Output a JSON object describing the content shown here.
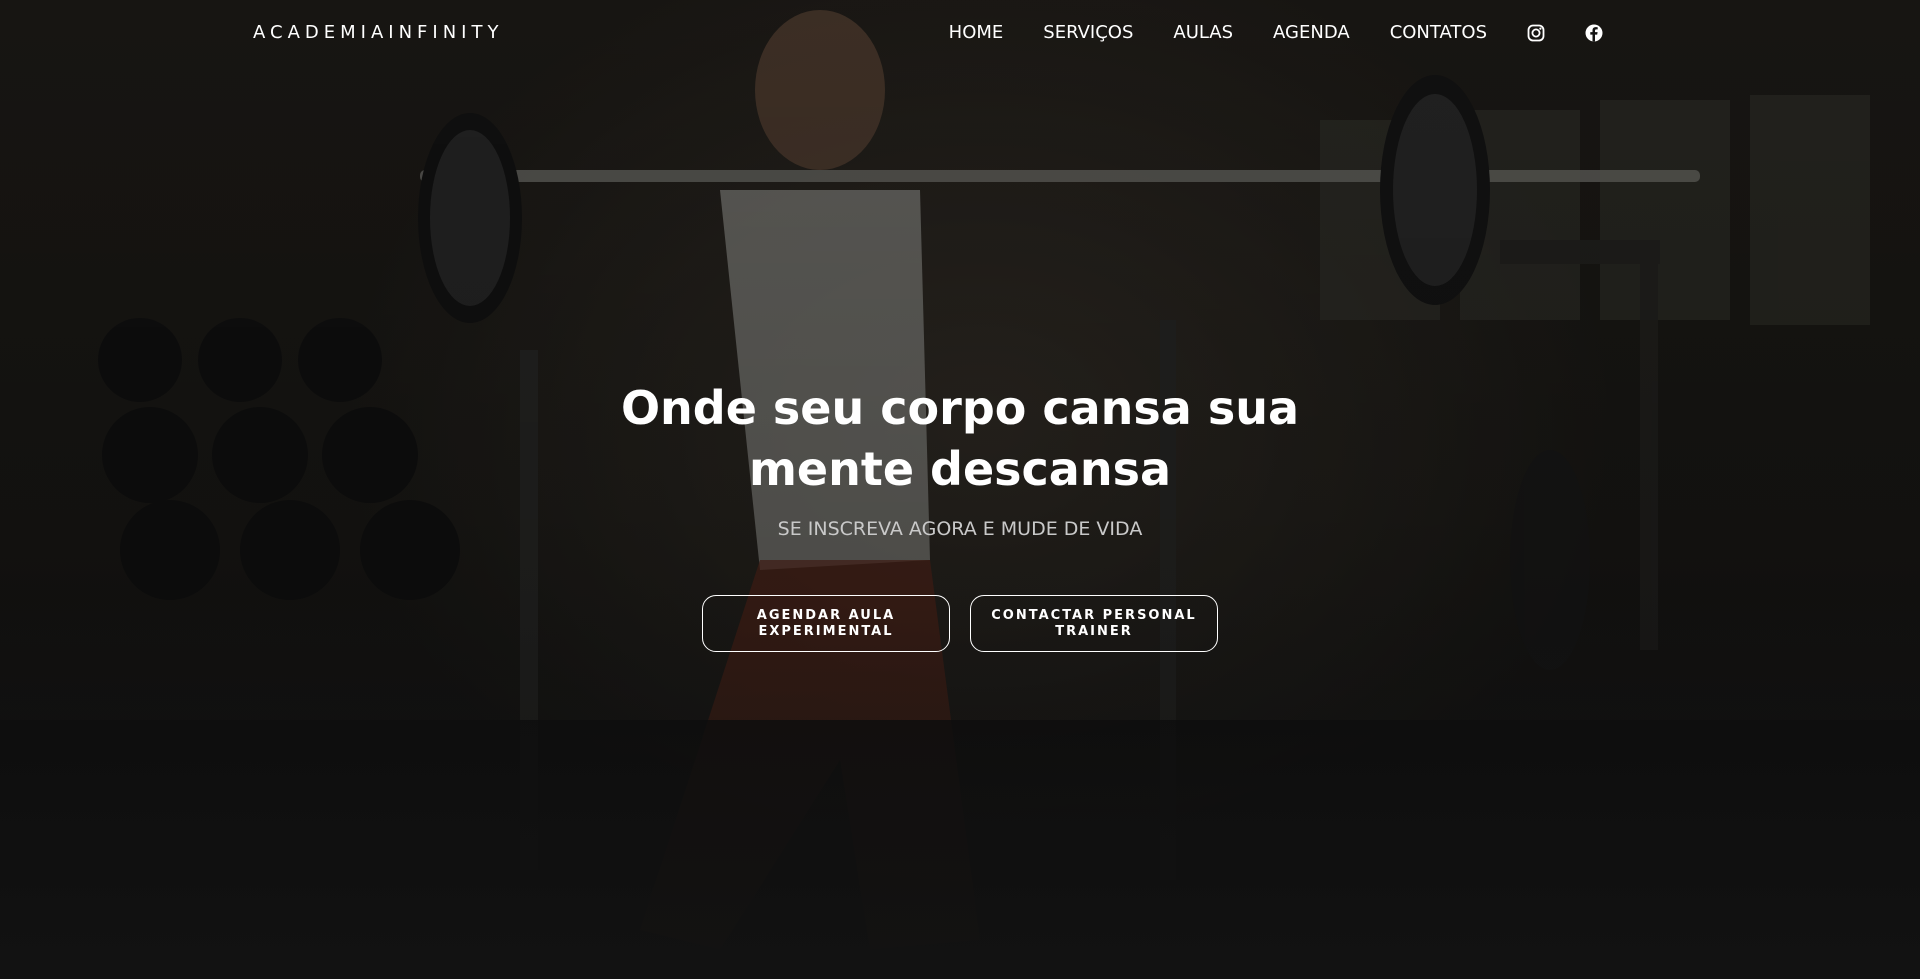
{
  "header": {
    "logo": "ACADEMIAINFINITY",
    "nav": [
      {
        "label": "HOME"
      },
      {
        "label": "SERVIÇOS"
      },
      {
        "label": "AULAS"
      },
      {
        "label": "AGENDA"
      },
      {
        "label": "CONTATOS"
      }
    ],
    "social": [
      {
        "icon": "instagram-icon"
      },
      {
        "icon": "facebook-icon"
      }
    ]
  },
  "hero": {
    "title": "Onde seu corpo cansa sua mente descansa",
    "subtitle": "SE INSCREVA AGORA E MUDE DE VIDA",
    "buttons": [
      {
        "label": "AGENDAR AULA EXPERIMENTAL"
      },
      {
        "label": "CONTACTAR PERSONAL TRAINER"
      }
    ]
  },
  "colors": {
    "text": "#ffffff",
    "subtitle": "#c9c9c9",
    "background": "#151515"
  }
}
